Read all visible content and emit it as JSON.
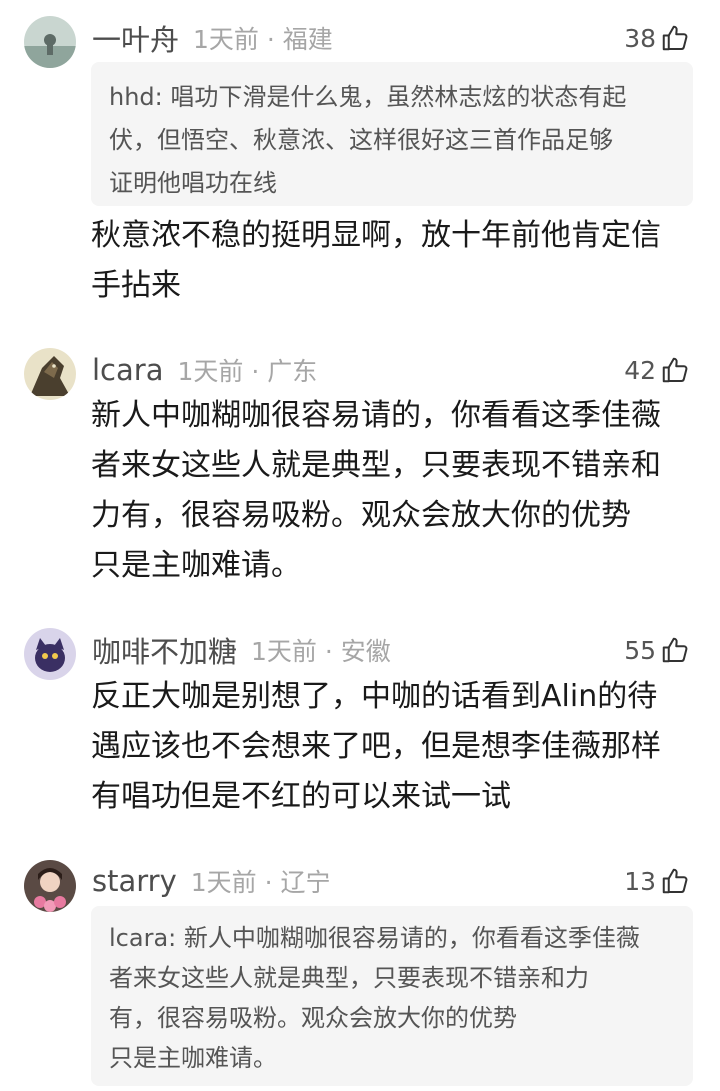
{
  "comments": [
    {
      "username": "一叶舟",
      "meta": "1天前 · 福建",
      "likes": "38",
      "quote_lines": [
        "hhd: 唱功下滑是什么鬼，虽然林志炫的状态有起",
        "伏，但悟空、秋意浓、这样很好这三首作品足够",
        "证明他唱功在线"
      ],
      "text_lines": [
        "秋意浓不稳的挺明显啊，放十年前他肯定信",
        "手拈来"
      ]
    },
    {
      "username": "lcara",
      "meta": "1天前 · 广东",
      "likes": "42",
      "text_lines": [
        "新人中咖糊咖很容易请的，你看看这季佳薇",
        "者来女这些人就是典型，只要表现不错亲和",
        "力有，很容易吸粉。观众会放大你的优势",
        "只是主咖难请。"
      ]
    },
    {
      "username": "咖啡不加糖",
      "meta": "1天前 · 安徽",
      "likes": "55",
      "text_lines": [
        "反正大咖是别想了，中咖的话看到Alin的待",
        "遇应该也不会想来了吧，但是想李佳薇那样",
        "有唱功但是不红的可以来试一试"
      ]
    },
    {
      "username": "starry",
      "meta": "1天前 · 辽宁",
      "likes": "13",
      "quote_lines": [
        "lcara: 新人中咖糊咖很容易请的，你看看这季佳薇",
        "者来女这些人就是典型，只要表现不错亲和力",
        "有，很容易吸粉。观众会放大你的优势",
        "只是主咖难请。"
      ]
    }
  ]
}
